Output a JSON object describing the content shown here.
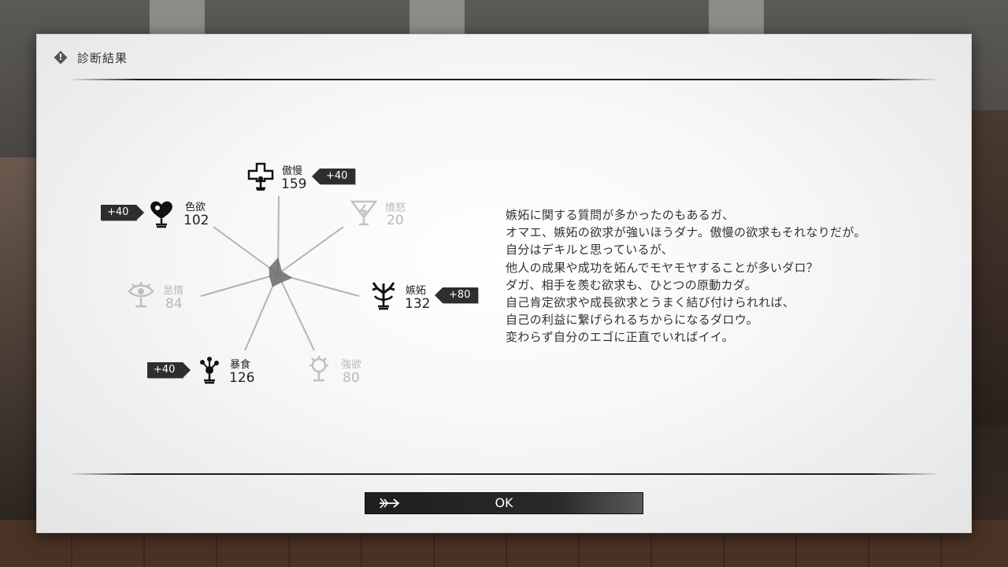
{
  "dialog": {
    "title": "診断結果",
    "ok_label": "OK"
  },
  "stats": {
    "pride": {
      "name": "傲慢",
      "value": "159",
      "bonus": "+40",
      "icon": "cross-chalice-icon",
      "active": true
    },
    "wrath": {
      "name": "憤怒",
      "value": "20",
      "bonus": "",
      "icon": "lightning-chalice-icon",
      "active": false
    },
    "envy": {
      "name": "嫉妬",
      "value": "132",
      "bonus": "+80",
      "icon": "branch-chalice-icon",
      "active": true
    },
    "greed": {
      "name": "強欲",
      "value": "80",
      "bonus": "",
      "icon": "gear-chalice-icon",
      "active": false
    },
    "gluttony": {
      "name": "暴食",
      "value": "126",
      "bonus": "+40",
      "icon": "splash-chalice-icon",
      "active": true
    },
    "sloth": {
      "name": "怠惰",
      "value": "84",
      "bonus": "",
      "icon": "eye-chalice-icon",
      "active": false
    },
    "lust": {
      "name": "色欲",
      "value": "102",
      "bonus": "+40",
      "icon": "heart-chalice-icon",
      "active": true
    }
  },
  "description": [
    "嫉妬に関する質問が多かったのもあるガ、",
    "オマエ、嫉妬の欲求が強いほうダナ。傲慢の欲求もそれなりだが。",
    "自分はデキルと思っているが、",
    "他人の成果や成功を妬んでモヤモヤすることが多いダロ？",
    "ダガ、相手を羨む欲求も、ひとつの原動カダ。",
    "自己肯定欲求や成長欲求とうまく結び付けられれば、",
    "自己の利益に繋げられるちからになるダロウ。",
    "変わらず自分のエゴに正直でいればイイ。"
  ],
  "colors": {
    "radar_fill": "#6b6b6b",
    "spoke": "#b3b3b3",
    "bonus_bg": "#2e2e2e"
  }
}
